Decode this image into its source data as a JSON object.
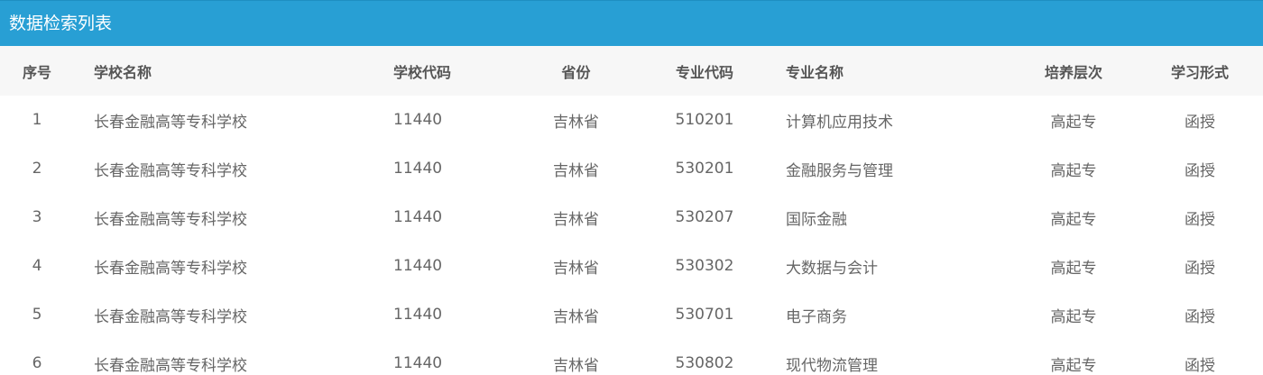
{
  "panel": {
    "title": "数据检索列表"
  },
  "table": {
    "headers": {
      "index": "序号",
      "school": "学校名称",
      "school_code": "学校代码",
      "province": "省份",
      "major_code": "专业代码",
      "major": "专业名称",
      "level": "培养层次",
      "form": "学习形式"
    },
    "rows": [
      {
        "index": "1",
        "school": "长春金融高等专科学校",
        "school_code": "11440",
        "province": "吉林省",
        "major_code": "510201",
        "major": "计算机应用技术",
        "level": "高起专",
        "form": "函授"
      },
      {
        "index": "2",
        "school": "长春金融高等专科学校",
        "school_code": "11440",
        "province": "吉林省",
        "major_code": "530201",
        "major": "金融服务与管理",
        "level": "高起专",
        "form": "函授"
      },
      {
        "index": "3",
        "school": "长春金融高等专科学校",
        "school_code": "11440",
        "province": "吉林省",
        "major_code": "530207",
        "major": "国际金融",
        "level": "高起专",
        "form": "函授"
      },
      {
        "index": "4",
        "school": "长春金融高等专科学校",
        "school_code": "11440",
        "province": "吉林省",
        "major_code": "530302",
        "major": "大数据与会计",
        "level": "高起专",
        "form": "函授"
      },
      {
        "index": "5",
        "school": "长春金融高等专科学校",
        "school_code": "11440",
        "province": "吉林省",
        "major_code": "530701",
        "major": "电子商务",
        "level": "高起专",
        "form": "函授"
      },
      {
        "index": "6",
        "school": "长春金融高等专科学校",
        "school_code": "11440",
        "province": "吉林省",
        "major_code": "530802",
        "major": "现代物流管理",
        "level": "高起专",
        "form": "函授"
      }
    ]
  },
  "colors": {
    "header_bg": "#289fd4",
    "table_head_bg": "#f7f7f7"
  }
}
